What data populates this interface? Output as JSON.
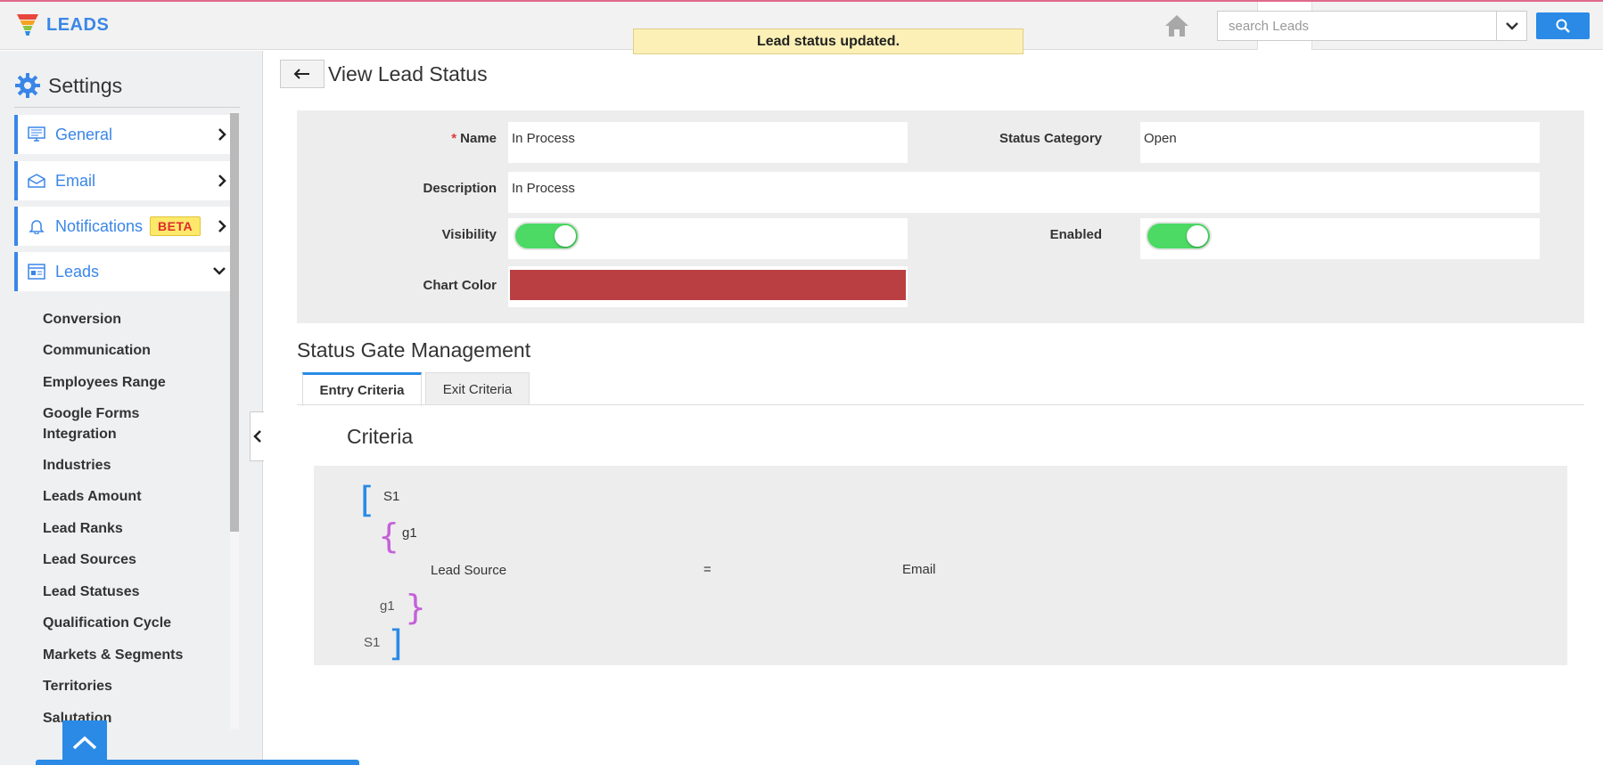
{
  "app": {
    "logo_text": "LEADS"
  },
  "header": {
    "search_placeholder": "search Leads",
    "icons": [
      "home-icon",
      "chart-icon",
      "more-icon"
    ]
  },
  "toast": "Lead status updated.",
  "sidebar": {
    "title": "Settings",
    "nav": [
      {
        "label": "General",
        "icon": "monitor-icon"
      },
      {
        "label": "Email",
        "icon": "envelope-icon"
      },
      {
        "label": "Notifications",
        "icon": "bell-icon",
        "badge": "BETA"
      },
      {
        "label": "Leads",
        "icon": "leads-icon"
      }
    ],
    "sub_items": [
      "Conversion",
      "Communication",
      "Employees Range",
      "Google Forms Integration",
      "Industries",
      "Leads Amount",
      "Lead Ranks",
      "Lead Sources",
      "Lead Statuses",
      "Qualification Cycle",
      "Markets & Segments",
      "Territories",
      "Salutation"
    ]
  },
  "page": {
    "title": "View Lead Status",
    "fields": {
      "name_label": "Name",
      "name_value": "In Process",
      "status_category_label": "Status Category",
      "status_category_value": "Open",
      "description_label": "Description",
      "description_value": "In Process",
      "visibility_label": "Visibility",
      "visibility_on": true,
      "enabled_label": "Enabled",
      "enabled_on": true,
      "chart_color_label": "Chart Color",
      "chart_color": "#b93f42"
    },
    "gate": {
      "title": "Status Gate Management",
      "tabs": [
        "Entry Criteria",
        "Exit Criteria"
      ],
      "criteria_title": "Criteria",
      "s_open": "S1",
      "g_open": "g1",
      "condition": {
        "field": "Lead Source",
        "op": "=",
        "value": "Email"
      },
      "g_close": "g1",
      "s_close": "S1"
    }
  }
}
